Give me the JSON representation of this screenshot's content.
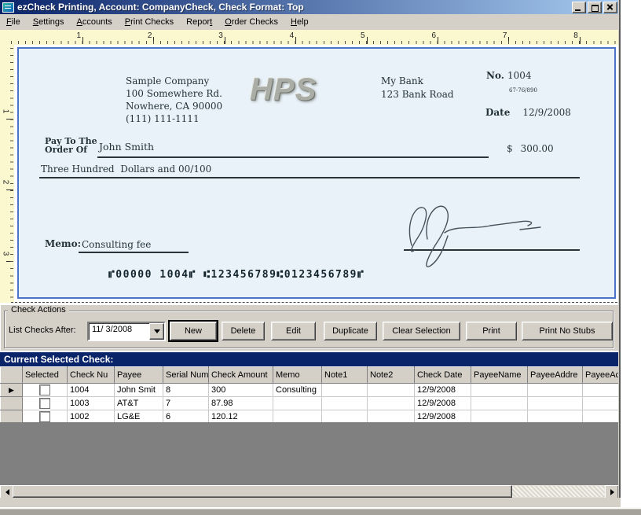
{
  "window": {
    "title": "ezCheck Printing, Account: CompanyCheck, Check Format: Top"
  },
  "menu": {
    "items": [
      {
        "label": "File",
        "u": 0
      },
      {
        "label": "Settings",
        "u": 0
      },
      {
        "label": "Accounts",
        "u": 0
      },
      {
        "label": "Print Checks",
        "u": 0
      },
      {
        "label": "Report",
        "u": 5
      },
      {
        "label": "Order Checks",
        "u": 0
      },
      {
        "label": "Help",
        "u": 0
      }
    ]
  },
  "rulers": {
    "horizontal": [
      "1",
      "2",
      "3",
      "4",
      "5",
      "6",
      "7",
      "8"
    ],
    "vertical": [
      "1",
      "2",
      "3"
    ]
  },
  "check": {
    "company": {
      "name": "Sample Company",
      "address1": "100 Somewhere Rd.",
      "address2": "Nowhere, CA 90000",
      "phone": "(111) 111-1111"
    },
    "watermark": "HPS",
    "bank": {
      "name": "My Bank",
      "address": "123 Bank Road",
      "fraction": "67-76/890"
    },
    "number_label": "No.",
    "number": "1004",
    "date_label": "Date",
    "date": "12/9/2008",
    "payto_label_line1": "Pay To The",
    "payto_label_line2": "Order Of",
    "payee": "John Smith",
    "dollar_sign": "$",
    "amount": "300.00",
    "amount_words": "Three Hundred  Dollars and 00/100",
    "memo_label": "Memo:",
    "memo": "Consulting fee",
    "micr": "⑈00000 1004⑈ ⑆123456789⑆0123456789⑈"
  },
  "actions": {
    "group_label": "Check Actions",
    "list_label": "List Checks After:",
    "date_value": "11/ 3/2008",
    "buttons": [
      "New",
      "Delete",
      "Edit",
      "Duplicate",
      "Clear Selection",
      "Print",
      "Print No Stubs"
    ]
  },
  "grid": {
    "title": "Current Selected Check:",
    "columns": [
      "Selected",
      "Check Nu",
      "Payee",
      "Serial Num",
      "Check Amount",
      "Memo",
      "Note1",
      "Note2",
      "Check Date",
      "PayeeName",
      "PayeeAddre",
      "PayeeAc"
    ],
    "rows": [
      {
        "current": true,
        "selected": false,
        "cells": [
          "1004",
          "John Smit",
          "8",
          "300",
          "Consulting",
          "",
          "",
          "12/9/2008",
          "",
          "",
          ""
        ]
      },
      {
        "current": false,
        "selected": false,
        "cells": [
          "1003",
          "AT&T",
          "7",
          "87.98",
          "",
          "",
          "",
          "12/9/2008",
          "",
          "",
          ""
        ]
      },
      {
        "current": false,
        "selected": false,
        "cells": [
          "1002",
          "LG&E",
          "6",
          "120.12",
          "",
          "",
          "",
          "12/9/2008",
          "",
          "",
          ""
        ]
      }
    ]
  }
}
